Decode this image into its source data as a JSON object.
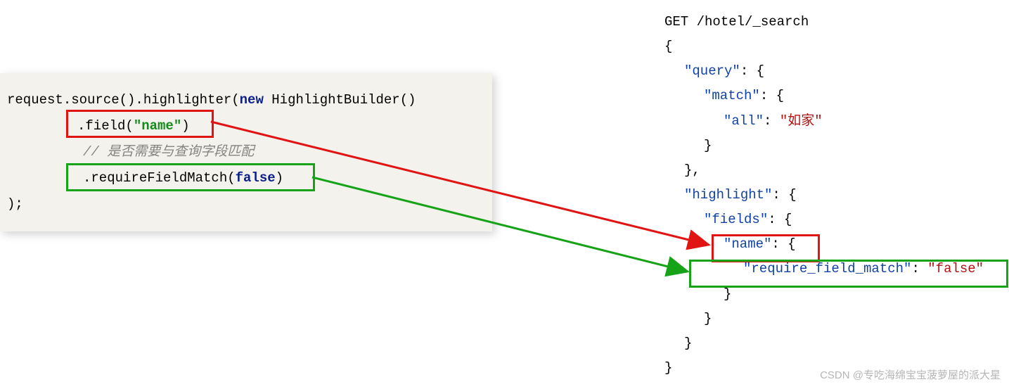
{
  "java": {
    "line1_pre": "request.source().highlighter(",
    "line1_new": "new",
    "line1_post": " HighlightBuilder()",
    "line2_method": ".field(",
    "line2_arg": "\"name\"",
    "line2_close": ")",
    "line3_comment": "//  是否需要与查询字段匹配",
    "line4_method": ".requireFieldMatch(",
    "line4_arg": "false",
    "line4_close": ")",
    "line5": ");"
  },
  "json": {
    "l1": "GET /hotel/_search",
    "l2": "{",
    "l3_key": "\"query\"",
    "l3_rest": ": {",
    "l4_key": "\"match\"",
    "l4_rest": ": {",
    "l5_key": "\"all\"",
    "l5_colon": ": ",
    "l5_val": "\"如家\"",
    "l6": "}",
    "l7": "},",
    "l8_key": "\"highlight\"",
    "l8_rest": ": {",
    "l9_key": "\"fields\"",
    "l9_rest": ": {",
    "l10_key": "\"name\"",
    "l10_rest": ": {",
    "l11_key": "\"require_field_match\"",
    "l11_colon": ": ",
    "l11_val": "\"false\"",
    "l12": "}",
    "l13": "}",
    "l14": "}",
    "l15": "}"
  },
  "watermark": "CSDN @专吃海绵宝宝菠萝屋的派大星",
  "chart_data": {
    "type": "table",
    "title": "Mapping between Java HighlightBuilder calls and Elasticsearch DSL JSON",
    "rows": [
      {
        "java": ".field(\"name\")",
        "json_path": "highlight.fields.name",
        "json_value": "{"
      },
      {
        "java": ".requireFieldMatch(false)",
        "json_path": "highlight.fields.name.require_field_match",
        "json_value": "\"false\""
      }
    ],
    "request": "GET /hotel/_search",
    "query": {
      "match": {
        "all": "如家"
      }
    }
  }
}
